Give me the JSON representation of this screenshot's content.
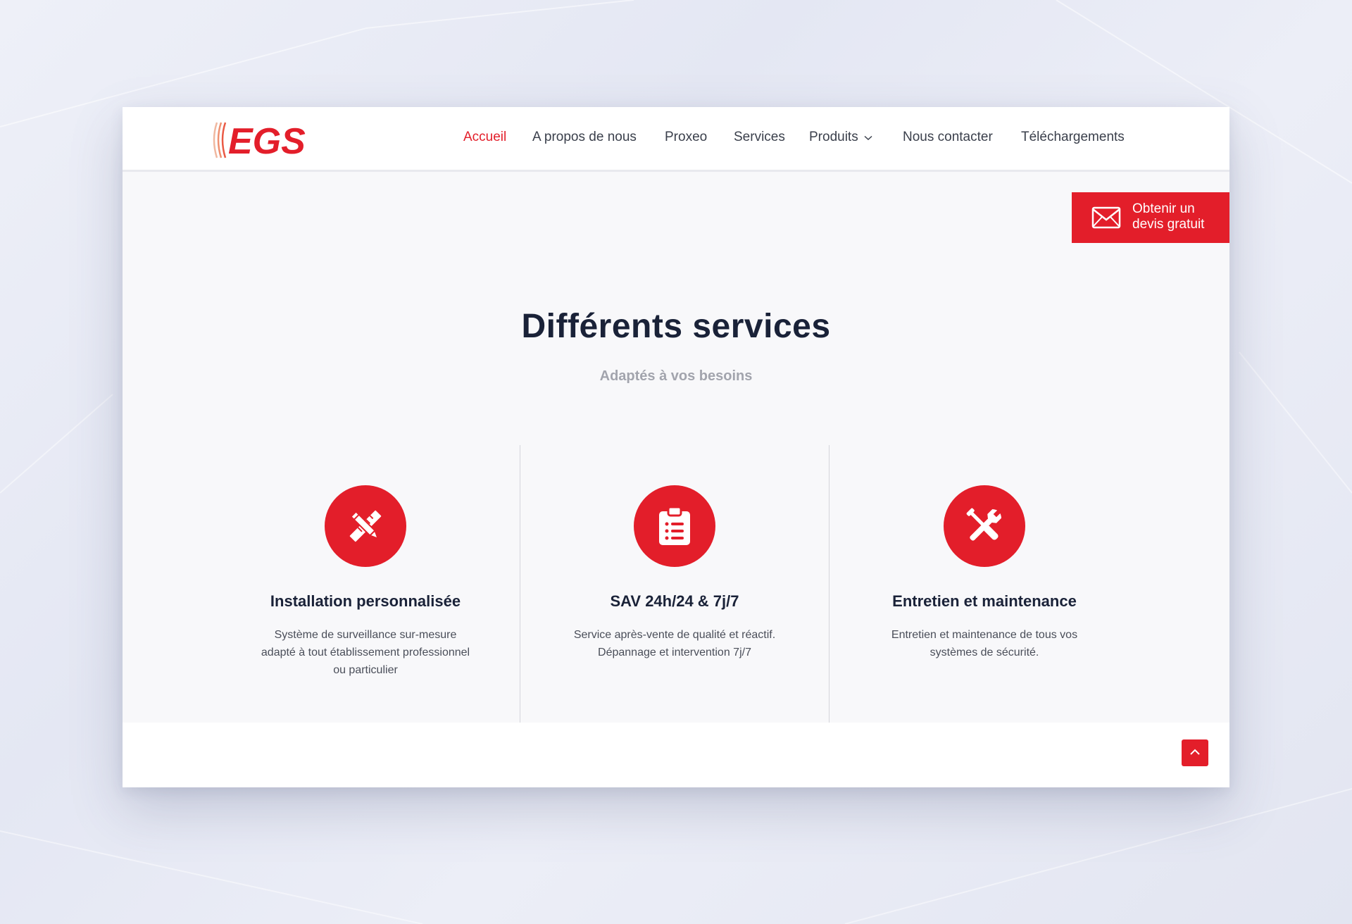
{
  "brand": {
    "logo_text": "EGS",
    "accent_color": "#e31e2a",
    "text_color": "#1a2238"
  },
  "nav": {
    "items": [
      {
        "label": "Accueil",
        "active": true
      },
      {
        "label": "A propos de nous"
      },
      {
        "label": "Proxeo"
      },
      {
        "label": "Services"
      },
      {
        "label": "Produits",
        "has_dropdown": true
      },
      {
        "label": "Nous contacter"
      },
      {
        "label": "Téléchargements"
      }
    ]
  },
  "cta": {
    "label": "Obtenir un devis gratuit",
    "icon": "envelope-icon"
  },
  "section": {
    "title": "Différents services",
    "subtitle": "Adaptés à vos besoins",
    "cards": [
      {
        "icon": "pencil-ruler-icon",
        "title": "Installation personnalisée",
        "text": "Système de surveillance sur-mesure adapté à tout établissement professionnel ou particulier"
      },
      {
        "icon": "clipboard-list-icon",
        "title": "SAV 24h/24 & 7j/7",
        "text": "Service après-vente de qualité et réactif. Dépannage et intervention 7j/7"
      },
      {
        "icon": "wrench-screwdriver-icon",
        "title": "Entretien et maintenance",
        "text": "Entretien et maintenance de tous vos systèmes de sécurité."
      }
    ]
  },
  "scroll_top": {
    "icon": "chevron-up-icon"
  }
}
